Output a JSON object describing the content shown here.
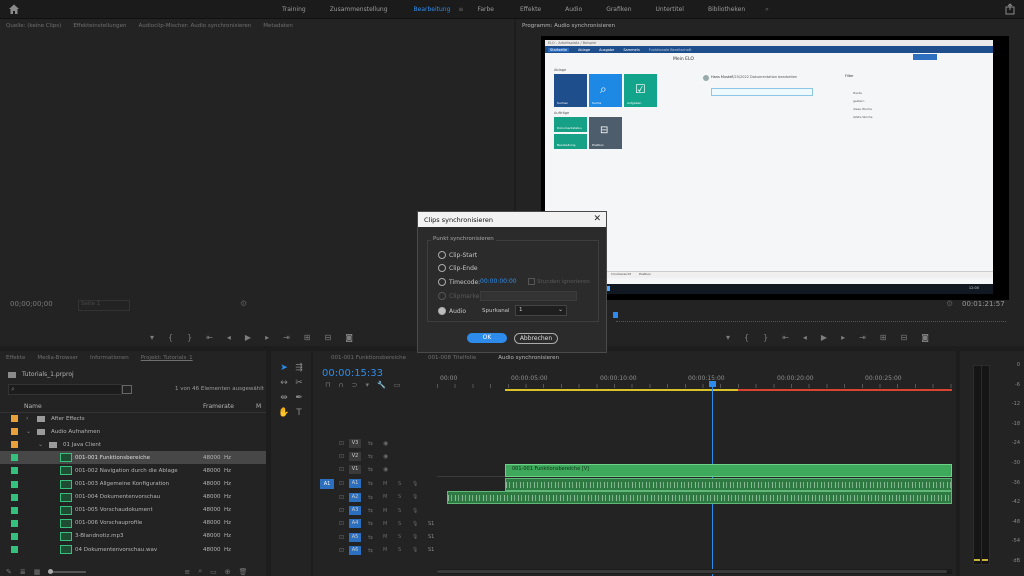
{
  "topbar": {
    "workspaces": [
      "Training",
      "Zusammenstellung",
      "Bearbeitung",
      "Farbe",
      "Effekte",
      "Audio",
      "Grafiken",
      "Untertitel",
      "Bibliotheken"
    ],
    "active_workspace": "Bearbeitung"
  },
  "source_panel": {
    "tabs": [
      "Quelle: (keine Clips)",
      "Effekteinstellungen",
      "Audioclip-Mischer: Audio synchronisieren",
      "Metadaten"
    ],
    "timecode": "00;00;00;00",
    "fit_label": "Seite 1"
  },
  "program_panel": {
    "tab": "Programm: Audio synchronisieren",
    "timecode_right": "00:01:21:57",
    "screen": {
      "header_left": "ELO - Arbeitsplatz / Beispiel",
      "menu": [
        "Startseite",
        "Ablage",
        "Ausgabe",
        "Sammeln",
        "Funktionale Bereitschaft"
      ],
      "title": "Mein ELO",
      "tiles_section": "Ablage",
      "tiles": [
        "Suchen",
        "Suche",
        "Aufgaben"
      ],
      "tiles2_section": "Aufträge",
      "tiles2": [
        "Dokumentstatus",
        "Bearbeitung",
        "Postbox"
      ],
      "user_name": "Hans Muster",
      "user_status": "7/25/2022 Dokumentation bearbeiten",
      "filter_heading": "Filter",
      "filter_options": [
        "Heute",
        "gestern",
        "diese Woche",
        "letzte Woche"
      ],
      "bottom_tabs": [
        "Posteingang",
        "Druckansicht",
        "Postbox"
      ],
      "taskbar_time": "12:00"
    }
  },
  "dialog": {
    "title": "Clips synchronisieren",
    "group_label": "Punkt synchronisieren",
    "options": {
      "clip_start": "Clip-Start",
      "clip_end": "Clip-Ende",
      "timecode": "Timecode:",
      "clip_marker": "Clipmarke",
      "audio": "Audio"
    },
    "timecode_value": "00:00:00:00",
    "ignore_hours": "Stunden ignorieren",
    "track_channel_label": "Spurkanal",
    "track_channel_value": "1",
    "ok": "OK",
    "cancel": "Abbrechen"
  },
  "project_panel": {
    "tabs": [
      "Effekte",
      "Media-Browser",
      "Informationen",
      "Projekt: Tutorials_1"
    ],
    "project_file": "Tutorials_1.prproj",
    "selection_info": "1 von 46 Elementen ausgewählt",
    "col_name": "Name",
    "col_rate": "Framerate",
    "col_extra": "M",
    "rows": [
      {
        "name": "After Effects",
        "rate": "",
        "unit": "",
        "type": "folder",
        "color": "#e8a13a",
        "indent": 0,
        "selected": false
      },
      {
        "name": "Audio Aufnahmen",
        "rate": "",
        "unit": "",
        "type": "folder",
        "color": "#e8a13a",
        "indent": 0,
        "selected": false
      },
      {
        "name": "01 Java Client",
        "rate": "",
        "unit": "",
        "type": "folder",
        "color": "#e8a13a",
        "indent": 1,
        "selected": false
      },
      {
        "name": "001-001 Funktionsbereiche",
        "rate": "48000",
        "unit": "Hz",
        "type": "audio",
        "color": "#35c07d",
        "indent": 2,
        "selected": true
      },
      {
        "name": "001-002 Navigation durch die Ablage",
        "rate": "48000",
        "unit": "Hz",
        "type": "audio",
        "color": "#35c07d",
        "indent": 2,
        "selected": false
      },
      {
        "name": "001-003 Allgemeine Konfiguration",
        "rate": "48000",
        "unit": "Hz",
        "type": "audio",
        "color": "#35c07d",
        "indent": 2,
        "selected": false
      },
      {
        "name": "001-004 Dokumentenvorschau",
        "rate": "48000",
        "unit": "Hz",
        "type": "audio",
        "color": "#35c07d",
        "indent": 2,
        "selected": false
      },
      {
        "name": "001-005 Vorschaudokument",
        "rate": "48000",
        "unit": "Hz",
        "type": "audio",
        "color": "#35c07d",
        "indent": 2,
        "selected": false
      },
      {
        "name": "001-006 Vorschauprofile",
        "rate": "48000",
        "unit": "Hz",
        "type": "audio",
        "color": "#35c07d",
        "indent": 2,
        "selected": false
      },
      {
        "name": "3-Blandnotiz.mp3",
        "rate": "48000",
        "unit": "Hz",
        "type": "audio",
        "color": "#35c07d",
        "indent": 2,
        "selected": false
      },
      {
        "name": "04 Dokumentenvorschau.wav",
        "rate": "48000",
        "unit": "Hz",
        "type": "audio",
        "color": "#35c07d",
        "indent": 2,
        "selected": false
      }
    ]
  },
  "timeline": {
    "tabs": [
      "001-001 Funktionsbereiche",
      "001-008 Titelfolie",
      "Audio synchronisieren"
    ],
    "timecode": "00:00:15:33",
    "ruler": [
      "00:00",
      "00:00:05:00",
      "00:00:10:00",
      "00:00:15:00",
      "00:00:20:00",
      "00:00:25:00"
    ],
    "video_tracks": [
      "V3",
      "V2",
      "V1"
    ],
    "audio_tracks": [
      "A1",
      "A2",
      "A3",
      "A4",
      "A5",
      "A6"
    ],
    "source_patch": "A1",
    "clip_v1": "001-001 Funktionsbereiche [V]",
    "s_labels": [
      "S1",
      "S1",
      "S1"
    ]
  },
  "meter": {
    "ticks": [
      "0",
      "-6",
      "-12",
      "-18",
      "-24",
      "-30",
      "-36",
      "-42",
      "-48",
      "-54",
      "dB"
    ]
  }
}
